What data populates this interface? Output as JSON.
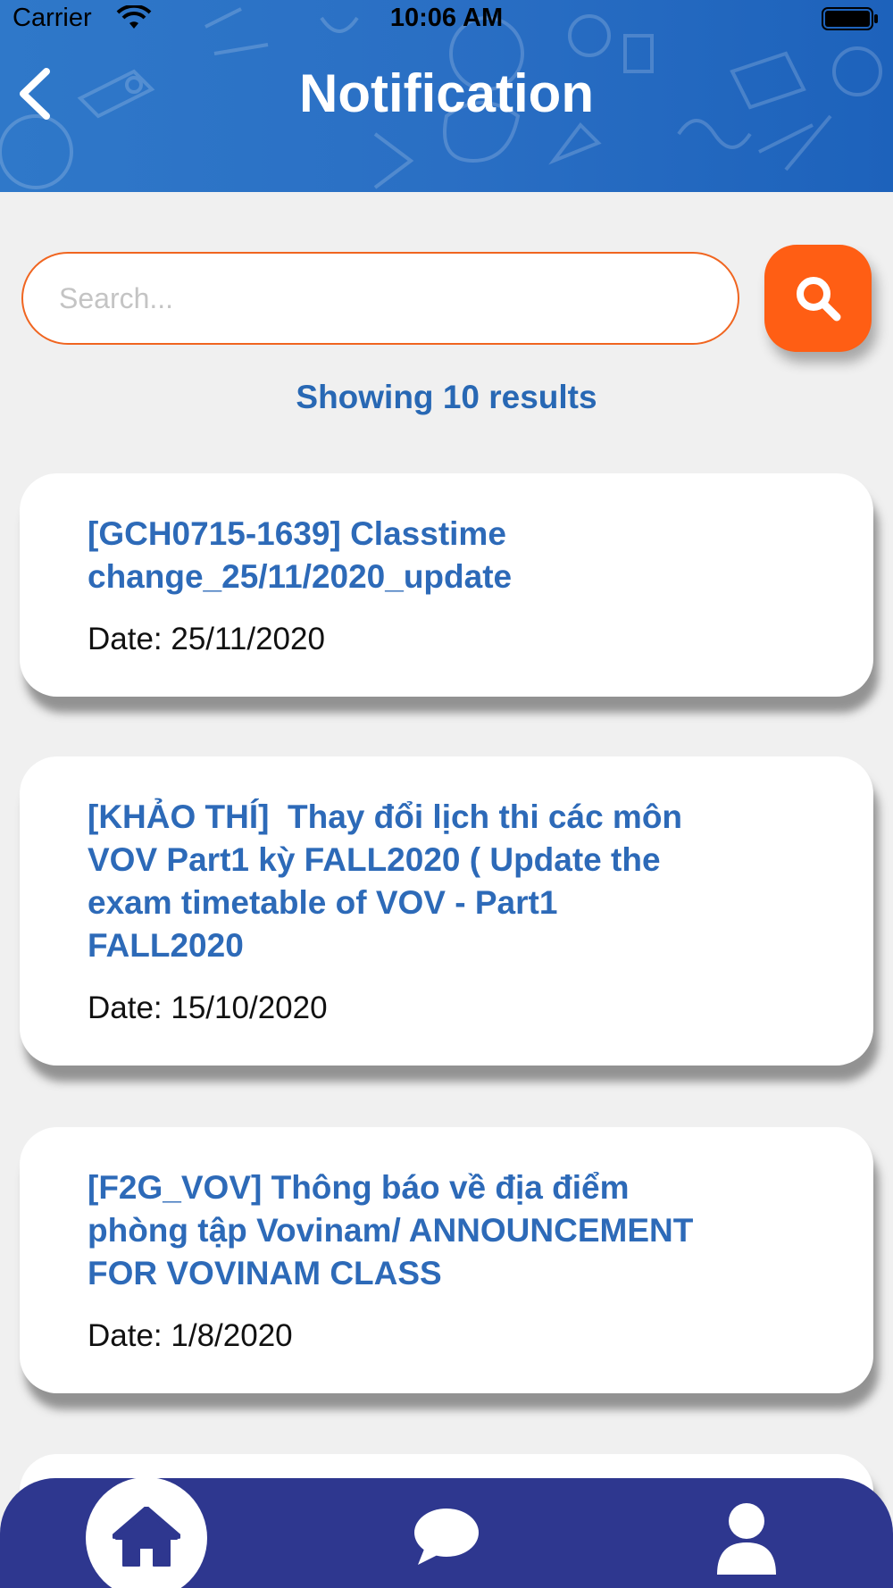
{
  "status_bar": {
    "carrier": "Carrier",
    "time": "10:06 AM"
  },
  "header": {
    "title": "Notification",
    "background_color": "#2a6fc4"
  },
  "search": {
    "placeholder": "Search...",
    "value": "",
    "accent_color": "#ff5e14"
  },
  "results": {
    "label": "Showing 10 results"
  },
  "notifications": [
    {
      "title": "[GCH0715-1639] Classtime\nchange_25/11/2020_update",
      "date": "Date: 25/11/2020"
    },
    {
      "title": "[KHẢO THÍ]  Thay đổi lịch thi các môn\nVOV Part1 kỳ FALL2020 ( Update the\nexam timetable of VOV - Part1\nFALL2020",
      "date": "Date: 15/10/2020"
    },
    {
      "title": "[F2G_VOV] Thông báo về địa điểm\nphòng tập Vovinam/ ANNOUNCEMENT\nFOR VOVINAM CLASS",
      "date": "Date: 1/8/2020"
    }
  ],
  "bottom_nav": {
    "items": [
      "home-icon",
      "chat-icon",
      "profile-icon"
    ],
    "active": "home-icon",
    "background_color": "#2e378f"
  }
}
